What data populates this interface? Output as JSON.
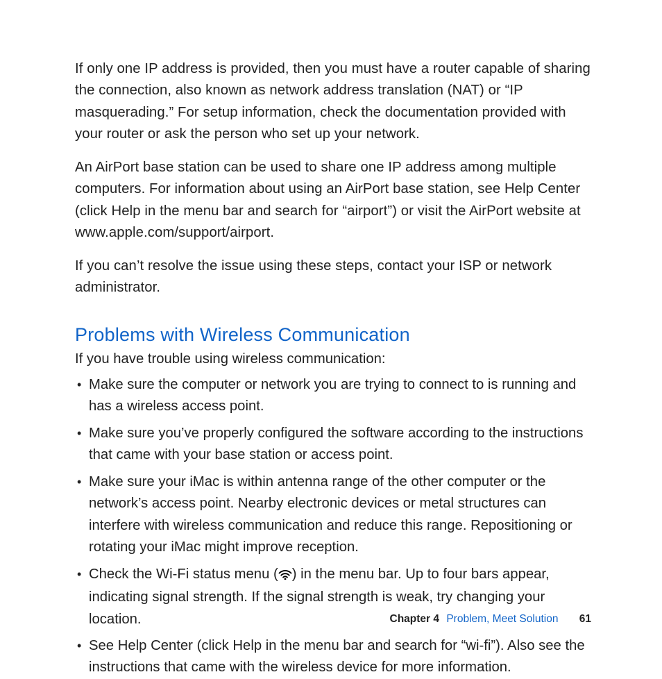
{
  "paragraphs": {
    "p1": "If only one IP address is provided, then you must have a router capable of sharing the connection, also known as network address translation (NAT) or “IP masquerading.” For setup information, check the documentation provided with your router or ask the person who set up your network.",
    "p2": "An AirPort base station can be used to share one IP address among multiple computers. For information about using an AirPort base station, see Help Center (click Help in the menu bar and search for “airport”) or visit the AirPort website at www.apple.com/support/airport.",
    "p3": "If you can’t resolve the issue using these steps, contact your ISP or network administrator."
  },
  "section": {
    "heading": "Problems with Wireless Communication",
    "intro": "If you have trouble using wireless communication:"
  },
  "bullets": {
    "b1": "Make sure the computer or network you are trying to connect to is running and has a wireless access point.",
    "b2": "Make sure you’ve properly configured the software according to the instructions that came with your base station or access point.",
    "b3": "Make sure your iMac is within antenna range of the other computer or the network’s access point. Nearby electronic devices or metal structures can interfere with wireless communication and reduce this range. Repositioning or rotating your iMac might improve reception.",
    "b4_pre": "Check the Wi-Fi status menu (",
    "b4_post": ") in the menu bar. Up to four bars appear, indicating signal strength. If the signal strength is weak, try changing your location.",
    "b5": "See Help Center (click Help in the menu bar and search for “wi-fi”). Also see the instructions that came with the wireless device for more information."
  },
  "footer": {
    "chapter_label": "Chapter 4",
    "chapter_title": "Problem, Meet Solution",
    "page_number": "61"
  }
}
